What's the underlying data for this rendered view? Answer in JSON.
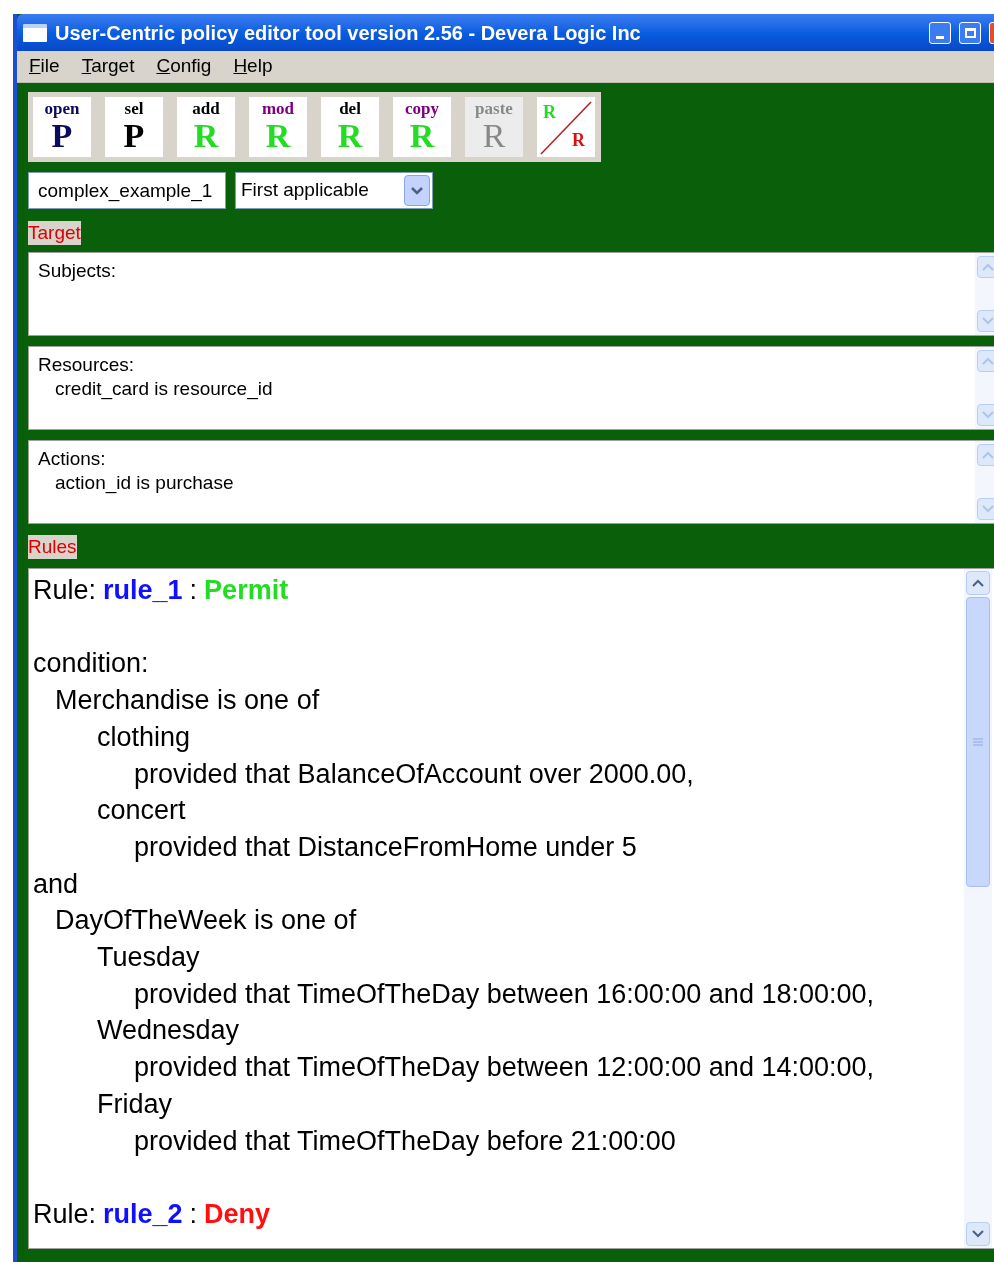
{
  "window": {
    "title": "User-Centric policy editor tool version 2.56 - Devera Logic Inc"
  },
  "menu": [
    {
      "label": "File"
    },
    {
      "label": "Target"
    },
    {
      "label": "Config"
    },
    {
      "label": "Help"
    }
  ],
  "toolbar": [
    {
      "kind": "letter",
      "label": {
        "text": "open",
        "color": "#0a0a60"
      },
      "letter": {
        "text": "P",
        "color": "#0a0a60"
      },
      "disabled": false
    },
    {
      "kind": "letter",
      "label": {
        "text": "sel",
        "color": "#000000"
      },
      "letter": {
        "text": "P",
        "color": "#000000"
      },
      "disabled": false
    },
    {
      "kind": "letter",
      "label": {
        "text": "add",
        "color": "#000000"
      },
      "letter": {
        "text": "R",
        "color": "#22dd22"
      },
      "disabled": false
    },
    {
      "kind": "letter",
      "label": {
        "text": "mod",
        "color": "#800080"
      },
      "letter": {
        "text": "R",
        "color": "#22dd22"
      },
      "disabled": false
    },
    {
      "kind": "letter",
      "label": {
        "text": "del",
        "color": "#000000"
      },
      "letter": {
        "text": "R",
        "color": "#22dd22"
      },
      "disabled": false
    },
    {
      "kind": "letter",
      "label": {
        "text": "copy",
        "color": "#800080"
      },
      "letter": {
        "text": "R",
        "color": "#22dd22"
      },
      "disabled": false
    },
    {
      "kind": "letter",
      "label": {
        "text": "paste",
        "color": "#888888"
      },
      "letter": {
        "text": "R",
        "color": "#888888"
      },
      "disabled": true
    },
    {
      "kind": "swap",
      "letters": [
        "R",
        "R"
      ]
    }
  ],
  "policy_name": {
    "value": "complex_example_1"
  },
  "combining_algorithm": {
    "value": "First applicable"
  },
  "target": {
    "label": "Target",
    "sections": [
      {
        "heading": "Subjects:"
      },
      {
        "heading": "Resources:",
        "lines": [
          "credit_card is resource_id"
        ]
      },
      {
        "heading": "Actions:",
        "lines": [
          "action_id is purchase"
        ]
      }
    ]
  },
  "rules": {
    "label": "Rules",
    "items": [
      {
        "prefix": "Rule:",
        "name": "rule_1",
        "separator": ":",
        "effect": "Permit",
        "kind": "permit",
        "body": [
          {
            "text": "condition:",
            "children": [
              {
                "text": "Merchandise is one of",
                "children": [
                  {
                    "text": "clothing",
                    "children": [
                      {
                        "text": "provided that BalanceOfAccount over 2000.00,"
                      }
                    ]
                  },
                  {
                    "text": "concert",
                    "children": [
                      {
                        "text": "provided that DistanceFromHome under 5"
                      }
                    ]
                  }
                ]
              }
            ]
          },
          {
            "text": "and",
            "children": [
              {
                "text": "DayOfTheWeek is one of",
                "children": [
                  {
                    "text": "Tuesday",
                    "children": [
                      {
                        "text": "provided that TimeOfTheDay between 16:00:00 and 18:00:00,"
                      }
                    ]
                  },
                  {
                    "text": "Wednesday",
                    "children": [
                      {
                        "text": "provided that TimeOfTheDay between 12:00:00 and 14:00:00,"
                      }
                    ]
                  },
                  {
                    "text": "Friday",
                    "children": [
                      {
                        "text": "provided that TimeOfTheDay before 21:00:00"
                      }
                    ]
                  }
                ]
              }
            ]
          }
        ]
      },
      {
        "prefix": "Rule:",
        "name": "rule_2",
        "separator": ":",
        "effect": "Deny",
        "kind": "deny"
      }
    ]
  }
}
